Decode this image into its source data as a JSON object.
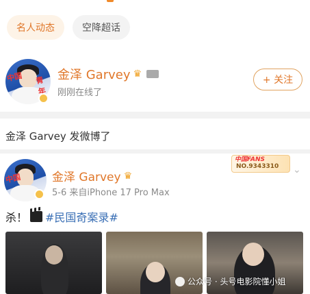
{
  "tabs": [
    {
      "label": "名人动态",
      "active": true
    },
    {
      "label": "空降超话",
      "active": false
    }
  ],
  "profile_card": {
    "name": "金泽 Garvey",
    "status": "刚刚在线了",
    "follow_label": "+ 关注",
    "avatar_text": "中国青年"
  },
  "activity_line": "金泽 Garvey 发微博了",
  "post": {
    "name": "金泽 Garvey",
    "meta": "5-6 来自iPhone 17 Pro Max",
    "fans_badge_title": "中国FANS",
    "fans_badge_number": "NO.9343310",
    "text_prefix": "杀！",
    "hashtag": "#民国奇案录#",
    "images": [
      "photo-1",
      "photo-2",
      "photo-3"
    ]
  },
  "watermark": "公众号 · 头号电影院懂小姐",
  "colors": {
    "accent_orange": "#e0772a",
    "hashtag_blue": "#3a6fb5",
    "chip_active_bg": "#fdf3e7"
  },
  "icons": [
    "crown-icon",
    "verified-badge-icon",
    "chevron-down-icon",
    "clapperboard-icon",
    "plus-icon"
  ]
}
